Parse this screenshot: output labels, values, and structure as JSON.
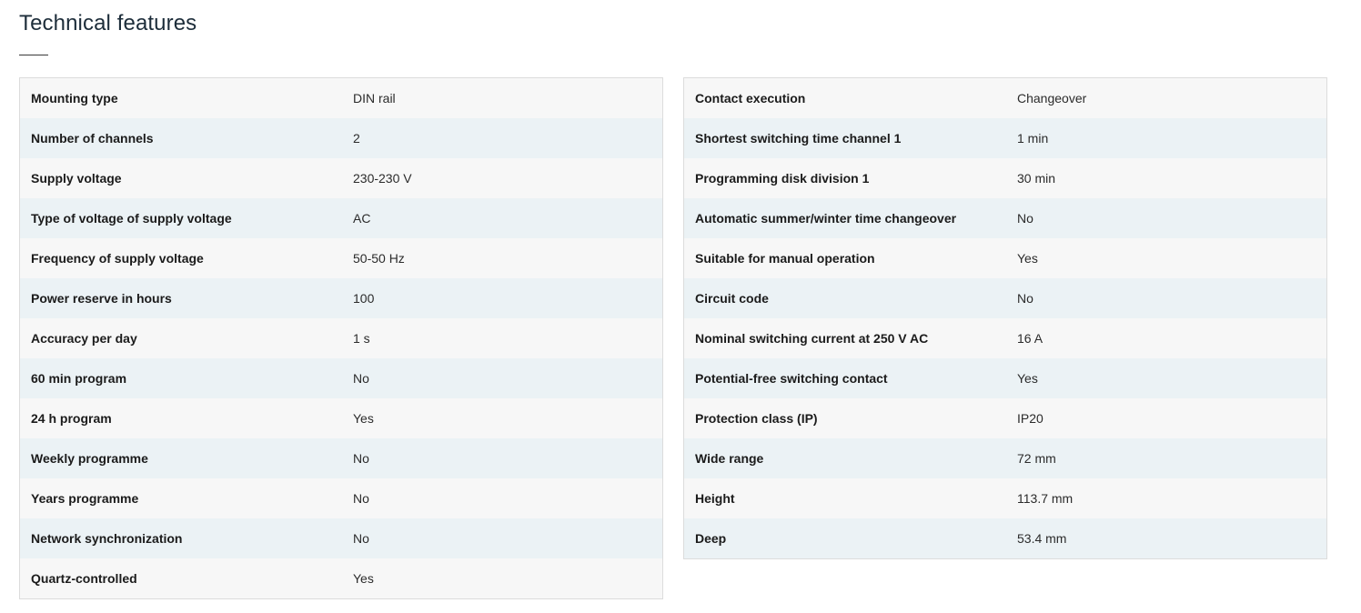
{
  "section": {
    "title": "Technical features"
  },
  "colors": {
    "row_odd": "#f7f7f7",
    "row_even": "#ebf2f5",
    "border": "#dcdcdc",
    "title": "#1d2d3a"
  },
  "left_table": {
    "rows": [
      {
        "label": "Mounting type",
        "value": "DIN rail"
      },
      {
        "label": "Number of channels",
        "value": "2"
      },
      {
        "label": "Supply voltage",
        "value": "230-230 V"
      },
      {
        "label": "Type of voltage of supply voltage",
        "value": "AC"
      },
      {
        "label": "Frequency of supply voltage",
        "value": "50-50 Hz"
      },
      {
        "label": "Power reserve in hours",
        "value": "100"
      },
      {
        "label": "Accuracy per day",
        "value": "1 s"
      },
      {
        "label": "60 min program",
        "value": "No"
      },
      {
        "label": "24 h program",
        "value": "Yes"
      },
      {
        "label": "Weekly programme",
        "value": "No"
      },
      {
        "label": "Years programme",
        "value": "No"
      },
      {
        "label": "Network synchronization",
        "value": "No"
      },
      {
        "label": "Quartz-controlled",
        "value": "Yes"
      }
    ]
  },
  "right_table": {
    "rows": [
      {
        "label": "Contact execution",
        "value": "Changeover"
      },
      {
        "label": "Shortest switching time channel 1",
        "value": "1 min"
      },
      {
        "label": "Programming disk division 1",
        "value": "30 min"
      },
      {
        "label": "Automatic summer/winter time changeover",
        "value": "No"
      },
      {
        "label": "Suitable for manual operation",
        "value": "Yes"
      },
      {
        "label": "Circuit code",
        "value": "No"
      },
      {
        "label": "Nominal switching current at 250 V AC",
        "value": "16 A"
      },
      {
        "label": "Potential-free switching contact",
        "value": "Yes"
      },
      {
        "label": "Protection class (IP)",
        "value": "IP20"
      },
      {
        "label": "Wide range",
        "value": "72 mm"
      },
      {
        "label": "Height",
        "value": "113.7 mm"
      },
      {
        "label": "Deep",
        "value": "53.4 mm"
      }
    ]
  }
}
